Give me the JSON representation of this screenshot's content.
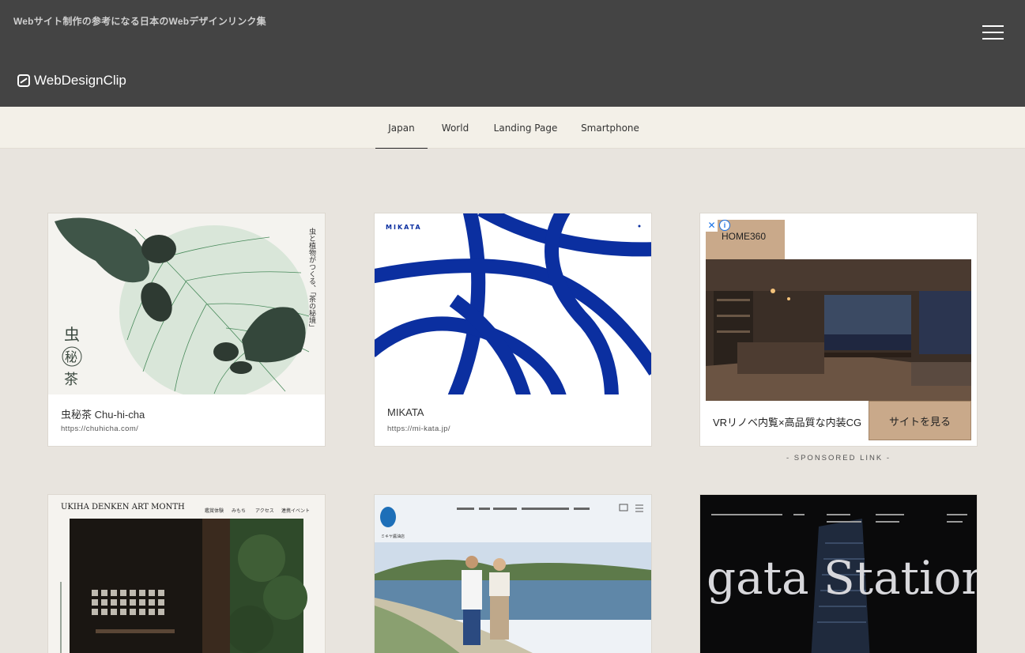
{
  "header": {
    "tagline": "Webサイト制作の参考になる日本のWebデザインリンク集",
    "logo_text": "WebDesignClip"
  },
  "nav": {
    "tabs": [
      {
        "label": "Japan",
        "active": true
      },
      {
        "label": "World",
        "active": false
      },
      {
        "label": "Landing Page",
        "active": false
      },
      {
        "label": "Smartphone",
        "active": false
      }
    ]
  },
  "cards": [
    {
      "title": "虫秘茶 Chu-hi-cha",
      "url": "https://chuhicha.com/",
      "thumb_text": "虫と植物がつくる、「茶の秘境」"
    },
    {
      "title": "MIKATA",
      "url": "https://mi-kata.jp/",
      "thumb_text": "MIKATA"
    }
  ],
  "ad": {
    "brand": "HOME360",
    "text": "VRリノベ内覧×高品質な内装CG",
    "button": "サイトを見る",
    "close_glyph": "✕",
    "info_glyph": "i",
    "sponsored": "- SPONSORED LINK -"
  },
  "row2": {
    "card4_text": "UKIHA DENKEN ART MONTH",
    "card4_nav": [
      "鑑賞体験",
      "みもち",
      "アクセス",
      "連携イベント"
    ],
    "card5_logo": "ミキヤ醤油店",
    "card6_text": "gata Station"
  },
  "colors": {
    "header_bg": "#444444",
    "nav_bg": "#f3f0e8",
    "page_bg": "#e8e4de",
    "mikata_blue": "#0b2fa0",
    "ad_accent": "#c9a98a"
  }
}
